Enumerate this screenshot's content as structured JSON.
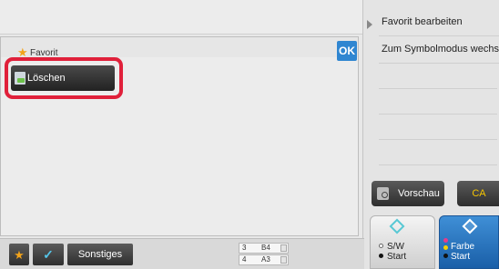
{
  "dialog": {
    "title": "Favorit",
    "ok_label": "OK",
    "delete_label": "Löschen"
  },
  "right_panel": {
    "items": [
      "Favorit bearbeiten",
      "Zum Symbolmodus wechseln"
    ],
    "preview_label": "Vorschau",
    "ca_label": "CA"
  },
  "start": {
    "bw_label": "S/W\nStart",
    "bw_line1": "S/W",
    "bw_line2": "Start",
    "color_line1": "Farbe",
    "color_line2": "Start"
  },
  "bottom": {
    "other_label": "Sonstiges",
    "trays": [
      {
        "number": "3",
        "size": "B4"
      },
      {
        "number": "4",
        "size": "A3"
      }
    ]
  },
  "colors": {
    "ok_blue": "#2f86d1",
    "highlight_red": "#e0203a",
    "ca_yellow": "#f5c400",
    "color_start_blue": "#1a5fa8",
    "star_orange": "#f2a31b"
  },
  "icons": [
    "star-icon",
    "delete-icon",
    "checkmark-icon",
    "preview-icon",
    "diamond-icon",
    "arrow-right-icon"
  ]
}
